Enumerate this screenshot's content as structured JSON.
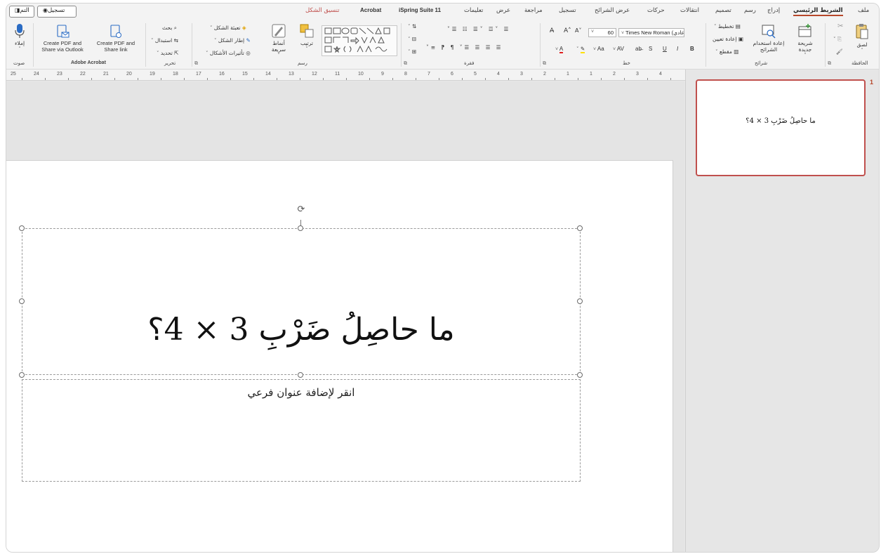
{
  "tabs": {
    "items": [
      {
        "label": "ملف"
      },
      {
        "label": "الشريط الرئيسي"
      },
      {
        "label": "إدراج"
      },
      {
        "label": "رسم"
      },
      {
        "label": "تصميم"
      },
      {
        "label": "انتقالات"
      },
      {
        "label": "حركات"
      },
      {
        "label": "عرض الشرائح"
      },
      {
        "label": "تسجيل"
      },
      {
        "label": "مراجعة"
      },
      {
        "label": "عرض"
      },
      {
        "label": "تعليمات"
      },
      {
        "label": "iSpring Suite 11"
      },
      {
        "label": "Acrobat"
      },
      {
        "label": "تنسيق الشكل"
      }
    ],
    "record_button": "تسجيل",
    "share_button": "التم"
  },
  "ribbon": {
    "clipboard": {
      "paste": "لصق",
      "group_label": "الحافظة"
    },
    "slides": {
      "new_slide": "شريحة جديدة",
      "reuse_slides": "إعادة استخدام الشرائح",
      "layout": "تخطيط",
      "reset": "إعادة تعيين",
      "section": "مقطع",
      "group_label": "شرائح"
    },
    "font": {
      "name": "Times New Roman (نص عادي)",
      "size": "60",
      "group_label": "خط",
      "bold": "B",
      "italic": "I",
      "underline": "U",
      "strike": "S",
      "case": "Aa"
    },
    "paragraph": {
      "group_label": "فقرة"
    },
    "drawing": {
      "arrange": "ترتيب",
      "quick_styles": "أنماط سريعة",
      "shape_fill": "تعبئة الشكل",
      "shape_outline": "إطار الشكل",
      "shape_effects": "تأثيرات الأشكال",
      "group_label": "رسم"
    },
    "editing": {
      "find": "بحث",
      "replace": "استبدال",
      "select": "تحديد",
      "group_label": "تحرير"
    },
    "acrobat": {
      "create_share_outlook": "Create PDF and Share via Outlook",
      "create_share_link": "Create PDF and Share link",
      "group_label": "Adobe Acrobat"
    },
    "voice": {
      "dictate": "إملاء",
      "group_label": "صوت"
    }
  },
  "ruler": {
    "numbers": [
      "25",
      "24",
      "23",
      "22",
      "21",
      "20",
      "19",
      "18",
      "17",
      "16",
      "15",
      "14",
      "13",
      "12",
      "11",
      "10",
      "9",
      "8",
      "7",
      "6",
      "5",
      "4",
      "3",
      "2",
      "1",
      "1",
      "2",
      "3",
      "4"
    ]
  },
  "slide": {
    "title": "ما حاصِلُ ضَرْبِ 3 × 4؟",
    "subtitle_placeholder": "انقر لإضافة عنوان فرعي"
  },
  "thumbnails": {
    "slide_number": "1",
    "thumb_title": "ما حاصِلُ ضَرْبِ 3 × 4؟"
  },
  "colors": {
    "accent": "#b7472a",
    "selection": "#c0504d"
  }
}
